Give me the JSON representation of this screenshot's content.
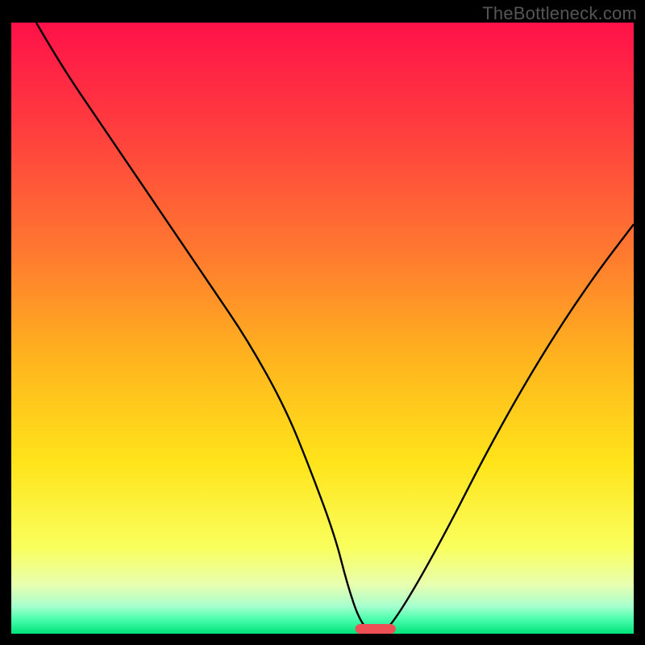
{
  "watermark": "TheBottleneck.com",
  "colors": {
    "frame": "#000000",
    "watermark": "#555555",
    "curve": "#000000",
    "marker_fill": "#ed5156",
    "gradient_stops": [
      {
        "offset": 0.0,
        "color": "#ff1149"
      },
      {
        "offset": 0.18,
        "color": "#ff3f3e"
      },
      {
        "offset": 0.38,
        "color": "#ff7a2f"
      },
      {
        "offset": 0.55,
        "color": "#ffb41e"
      },
      {
        "offset": 0.72,
        "color": "#ffe41a"
      },
      {
        "offset": 0.86,
        "color": "#f9ff5e"
      },
      {
        "offset": 0.92,
        "color": "#e8ffb0"
      },
      {
        "offset": 0.955,
        "color": "#a6ffce"
      },
      {
        "offset": 0.975,
        "color": "#4fffb0"
      },
      {
        "offset": 1.0,
        "color": "#00e47a"
      }
    ]
  },
  "chart_data": {
    "type": "line",
    "title": "",
    "xlabel": "",
    "ylabel": "",
    "xlim": [
      0,
      100
    ],
    "ylim": [
      0,
      100
    ],
    "series": [
      {
        "name": "bottleneck-curve",
        "x": [
          4,
          8,
          14,
          20,
          26,
          32,
          38,
          44,
          48,
          52,
          54,
          56,
          58,
          60,
          64,
          70,
          76,
          82,
          88,
          94,
          100
        ],
        "y": [
          100,
          93,
          84,
          75,
          66,
          57,
          48,
          37,
          27,
          16,
          8,
          2,
          0,
          0,
          6,
          17,
          29,
          40,
          50,
          59,
          67
        ]
      }
    ],
    "marker": {
      "x_center": 58.5,
      "width": 6.5,
      "y": 0.8
    }
  }
}
